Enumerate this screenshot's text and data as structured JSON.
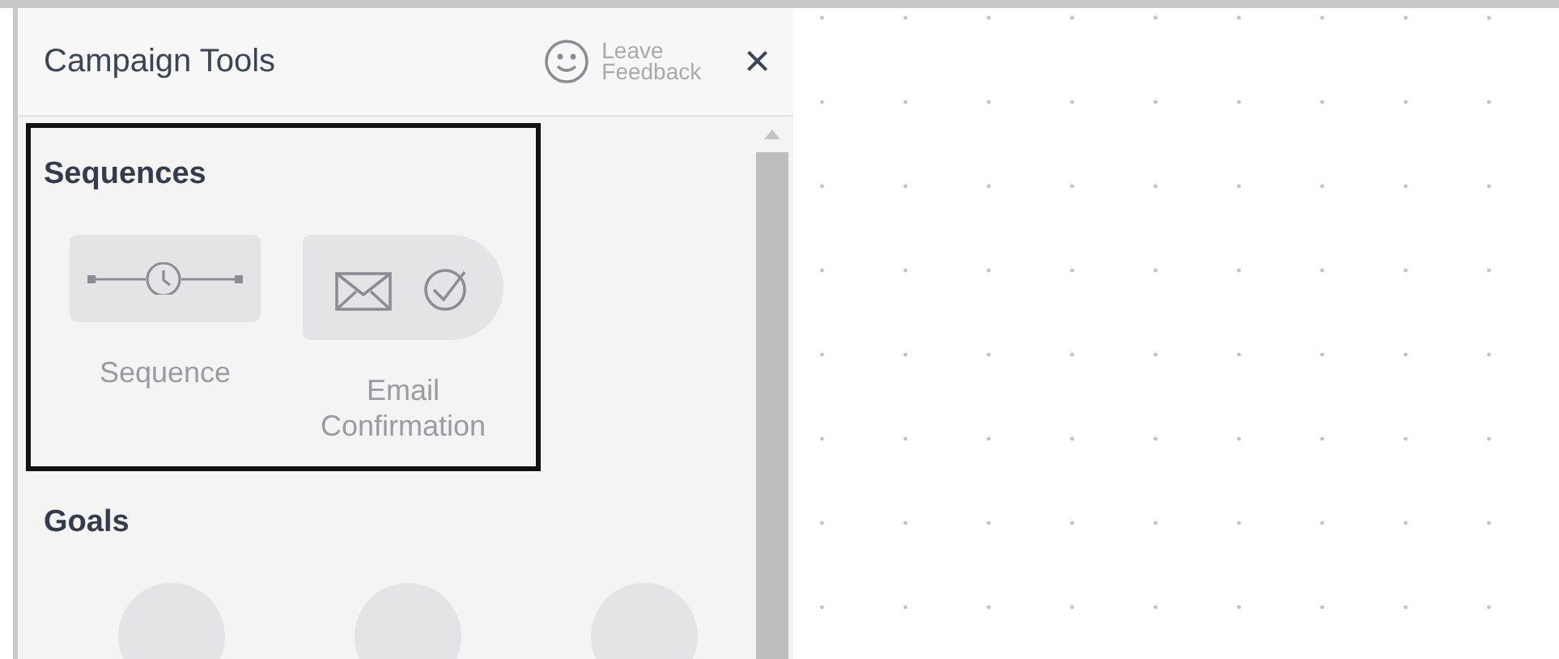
{
  "panel": {
    "title": "Campaign Tools",
    "feedback_label": "Leave Feedback",
    "close": "×"
  },
  "sections": [
    {
      "title": "Sequences",
      "highlighted": true,
      "tools": [
        {
          "kind": "sequence",
          "label": "Sequence"
        },
        {
          "kind": "email-confirmation",
          "label": "Email Confirmation"
        }
      ]
    },
    {
      "title": "Goals",
      "highlighted": false,
      "tools": [
        {
          "kind": "goal"
        },
        {
          "kind": "goal"
        },
        {
          "kind": "goal"
        }
      ]
    }
  ]
}
